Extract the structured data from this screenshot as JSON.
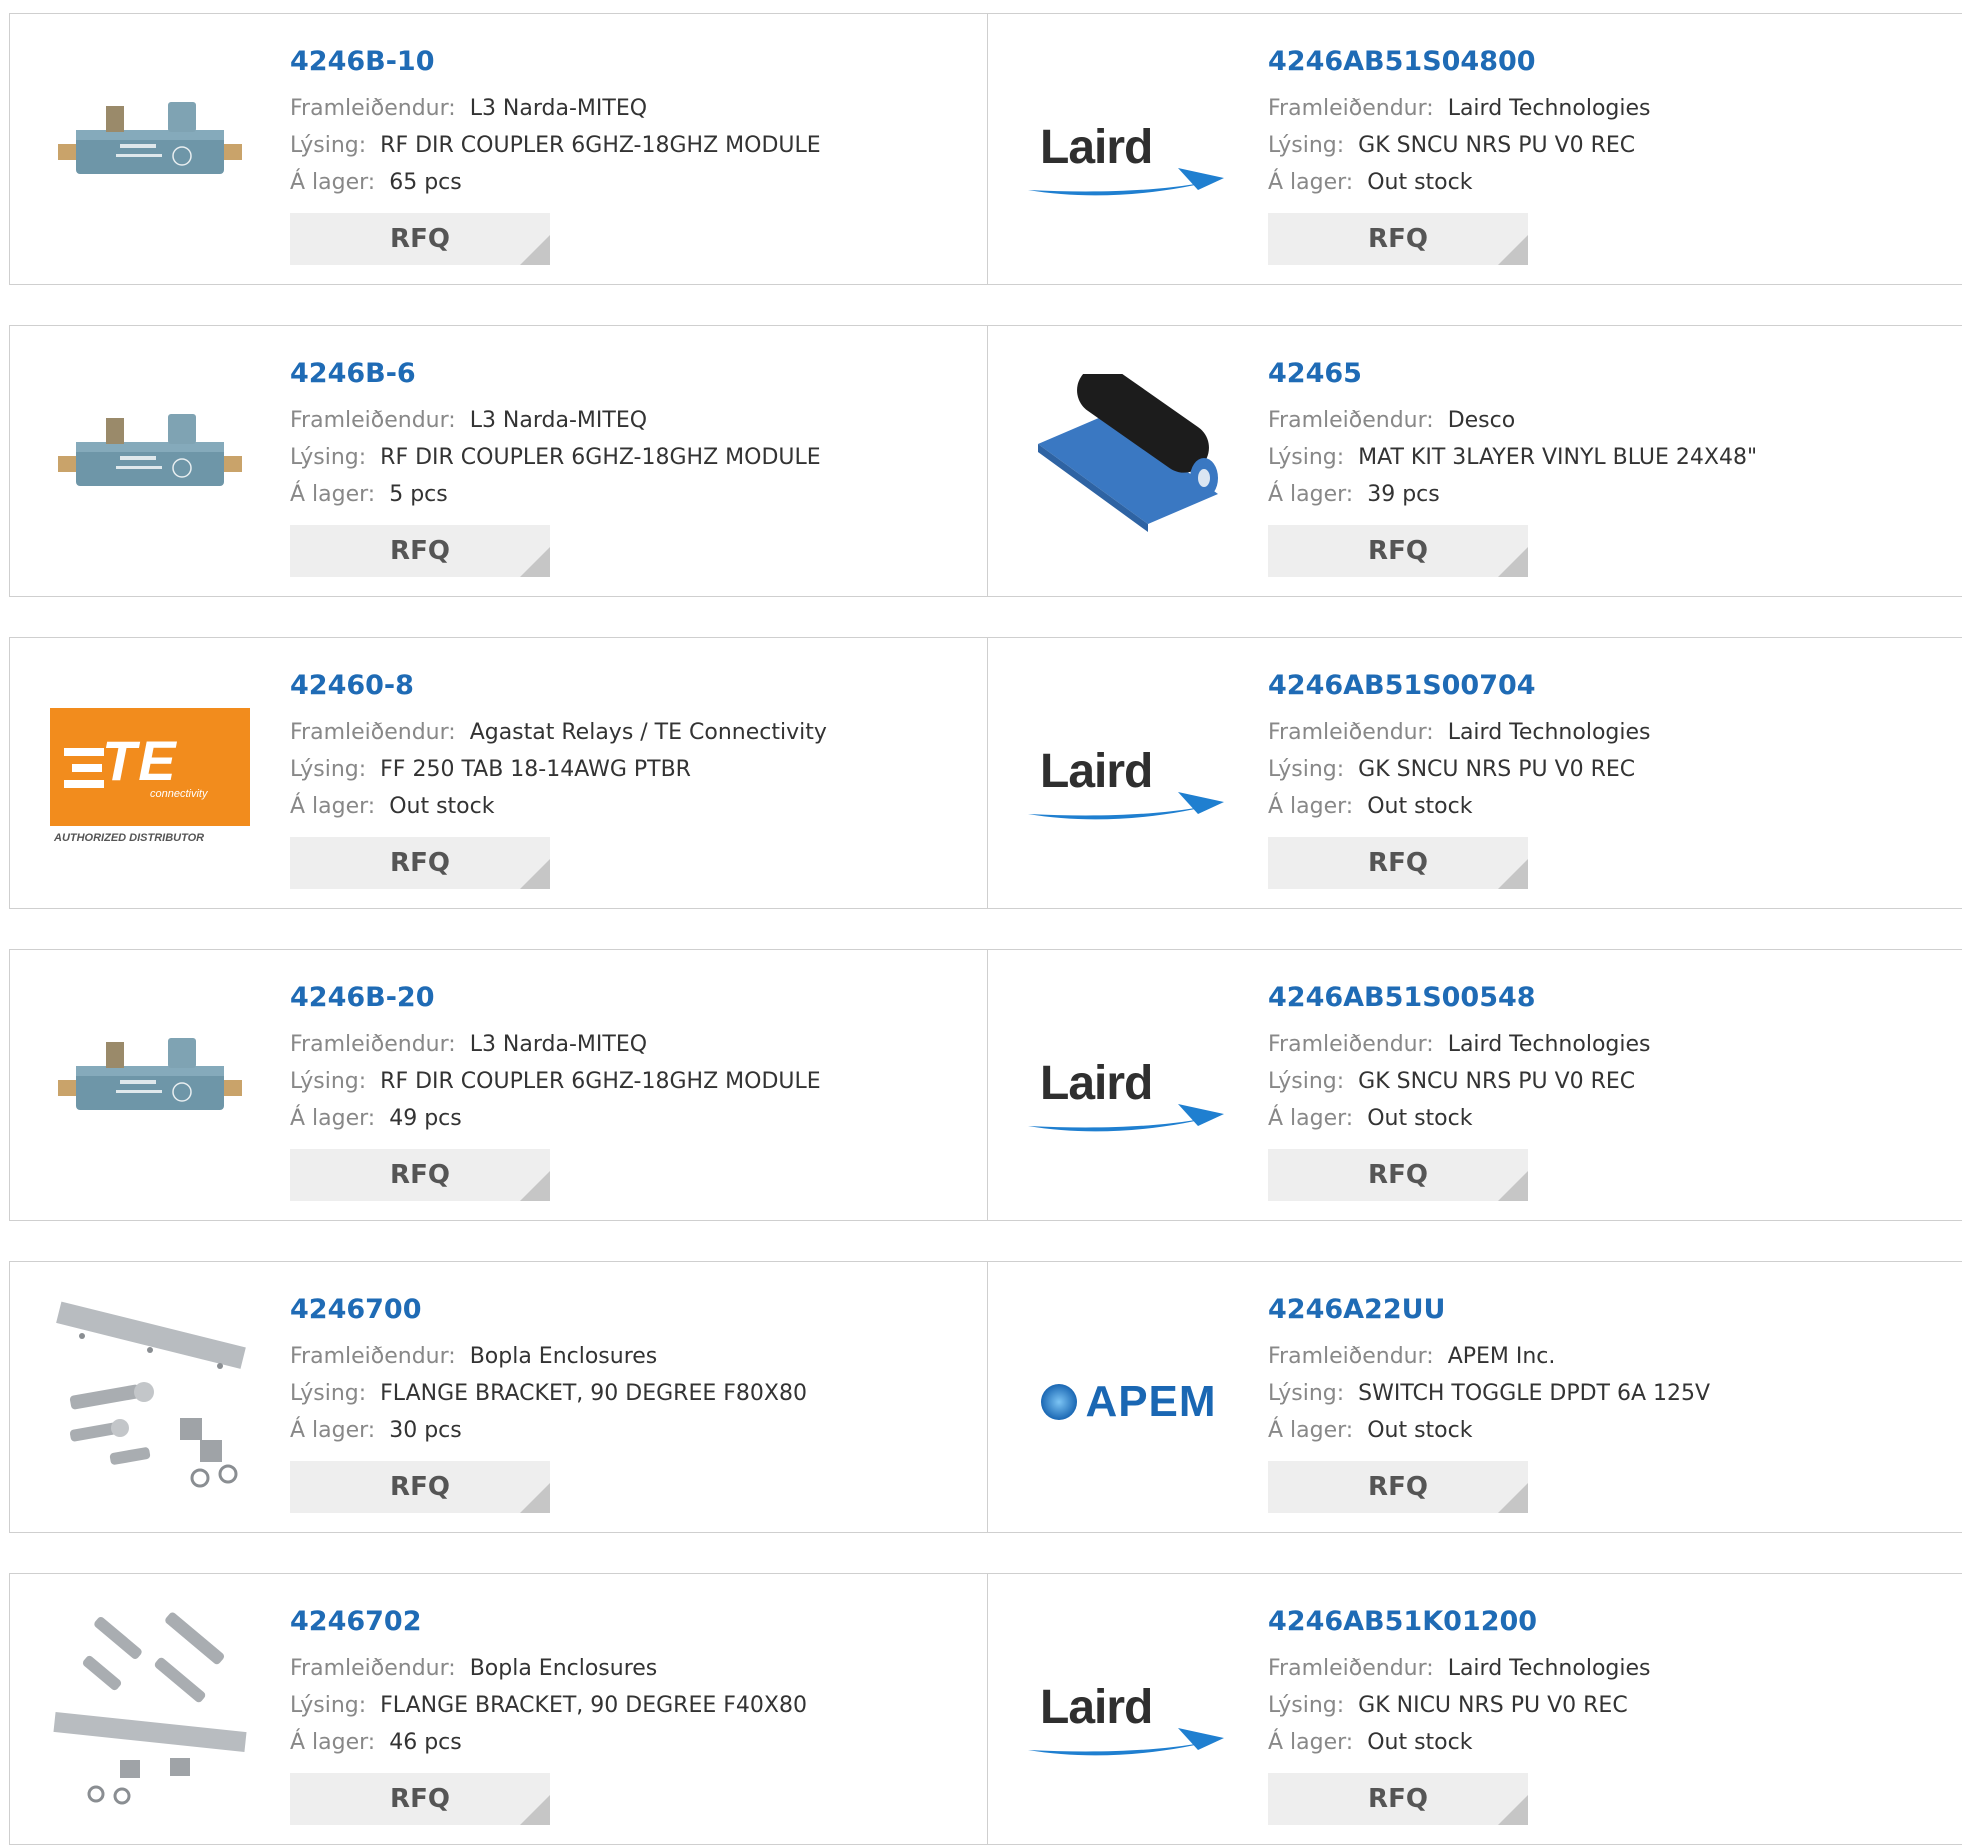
{
  "labels": {
    "manufacturer": "Framleiðendur:",
    "description": "Lýsing:",
    "stock": "Á lager:",
    "rfq": "RFQ"
  },
  "rows": [
    {
      "left": {
        "part": "4246B-10",
        "manufacturer": "L3 Narda-MITEQ",
        "description": "RF DIR COUPLER 6GHZ-18GHZ MODULE",
        "stock": "65 pcs",
        "image": "directional-coupler-photo"
      },
      "right": {
        "part": "4246AB51S04800",
        "manufacturer": "Laird Technologies",
        "description": "GK SNCU NRS PU V0 REC",
        "stock": "Out stock",
        "image": "laird-logo",
        "logo_text": "Laird"
      }
    },
    {
      "left": {
        "part": "4246B-6",
        "manufacturer": "L3 Narda-MITEQ",
        "description": "RF DIR COUPLER 6GHZ-18GHZ MODULE",
        "stock": "5 pcs",
        "image": "directional-coupler-photo"
      },
      "right": {
        "part": "42465",
        "manufacturer": "Desco",
        "description": "MAT KIT 3LAYER VINYL BLUE 24X48\"",
        "stock": "39 pcs",
        "image": "rolled-mat-photo"
      }
    },
    {
      "left": {
        "part": "42460-8",
        "manufacturer": "Agastat Relays / TE Connectivity",
        "description": "FF 250 TAB 18-14AWG PTBR",
        "stock": "Out stock",
        "image": "te-connectivity-logo",
        "logo_text": "TE",
        "logo_sub": "connectivity",
        "logo_caption": "AUTHORIZED DISTRIBUTOR"
      },
      "right": {
        "part": "4246AB51S00704",
        "manufacturer": "Laird Technologies",
        "description": "GK SNCU NRS PU V0 REC",
        "stock": "Out stock",
        "image": "laird-logo",
        "logo_text": "Laird"
      }
    },
    {
      "left": {
        "part": "4246B-20",
        "manufacturer": "L3 Narda-MITEQ",
        "description": "RF DIR COUPLER 6GHZ-18GHZ MODULE",
        "stock": "49 pcs",
        "image": "directional-coupler-photo"
      },
      "right": {
        "part": "4246AB51S00548",
        "manufacturer": "Laird Technologies",
        "description": "GK SNCU NRS PU V0 REC",
        "stock": "Out stock",
        "image": "laird-logo",
        "logo_text": "Laird"
      }
    },
    {
      "left": {
        "part": "4246700",
        "manufacturer": "Bopla Enclosures",
        "description": "FLANGE BRACKET, 90 DEGREE F80X80",
        "stock": "30 pcs",
        "image": "flange-bracket-photo"
      },
      "right": {
        "part": "4246A22UU",
        "manufacturer": "APEM Inc.",
        "description": "SWITCH TOGGLE DPDT 6A 125V",
        "stock": "Out stock",
        "image": "apem-logo",
        "logo_text": "APEM"
      }
    },
    {
      "left": {
        "part": "4246702",
        "manufacturer": "Bopla Enclosures",
        "description": "FLANGE BRACKET, 90 DEGREE F40X80",
        "stock": "46 pcs",
        "image": "flange-bracket-photo"
      },
      "right": {
        "part": "4246AB51K01200",
        "manufacturer": "Laird Technologies",
        "description": "GK NICU NRS PU V0 REC",
        "stock": "Out stock",
        "image": "laird-logo",
        "logo_text": "Laird"
      }
    }
  ],
  "colors": {
    "part_link": "#1f6bb5",
    "label": "#888888",
    "value": "#333333",
    "border": "#cfcfcf",
    "rfq_bg": "#eeeeee",
    "te_orange": "#f28c1d",
    "apem_blue": "#1a67b3"
  }
}
